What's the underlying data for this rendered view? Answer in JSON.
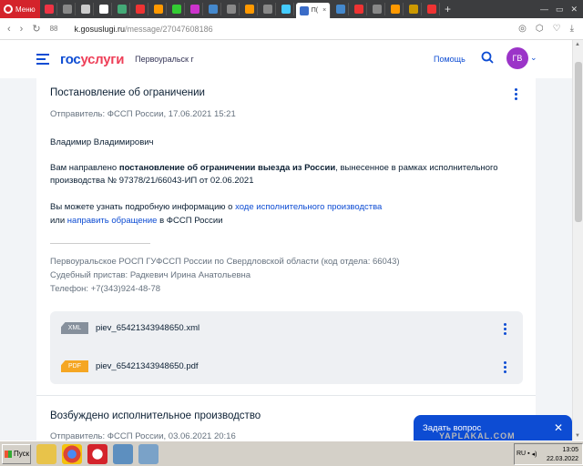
{
  "browser": {
    "menu_label": "Меню",
    "active_tab_label": "П(",
    "url_host": "k.gosuslugi.ru",
    "url_path": "/message/27047608186",
    "tab_colors": [
      "#e34",
      "#888",
      "#ccc",
      "#fff",
      "#4a7",
      "#e33",
      "#f90",
      "#3c3",
      "#c3c",
      "#48c",
      "#888",
      "#f90",
      "#888",
      "#4cf",
      "#48c",
      "#e33",
      "#888",
      "#f90",
      "#c90",
      "#e33"
    ]
  },
  "header": {
    "logo_gos": "гос",
    "logo_uslugi": "услуги",
    "city": "Первоуральск г",
    "help": "Помощь",
    "avatar_initials": "ГВ"
  },
  "message": {
    "title": "Постановление об ограничении",
    "sender": "Отправитель: ФССП России, 17.06.2021 15:21",
    "greeting": "Владимир Владимирович",
    "p1_before": "Вам направлено ",
    "p1_bold": "постановление об ограничении выезда из России",
    "p1_after": ", вынесенное в рамках исполнительного производства № 97378/21/66043-ИП от 02.06.2021",
    "p2_before": "Вы можете узнать подробную информацию о ",
    "p2_link1": "ходе исполнительного производства",
    "p2_mid": "или ",
    "p2_link2": "направить обращение",
    "p2_after": " в ФССП России",
    "sig_line1": "Первоуральское РОСП ГУФССП России по Свердловской области (код отдела: 66043)",
    "sig_line2": "Судебный пристав: Радкевич Ирина Анатольевна",
    "sig_line3": "Телефон: +7(343)924-48-78",
    "files": [
      {
        "type": "XML",
        "name": "piev_65421343948650.xml"
      },
      {
        "type": "PDF",
        "name": "piev_65421343948650.pdf"
      }
    ]
  },
  "message2": {
    "title": "Возбуждено исполнительное производство",
    "sender": "Отправитель: ФССП России, 03.06.2021 20:16"
  },
  "chat": {
    "label": "Задать вопрос"
  },
  "watermark": "YAPLAKAL.COM",
  "taskbar": {
    "start_label": "Пуск",
    "time": "13:05",
    "date": "22.03.2022",
    "lang": "RU"
  }
}
